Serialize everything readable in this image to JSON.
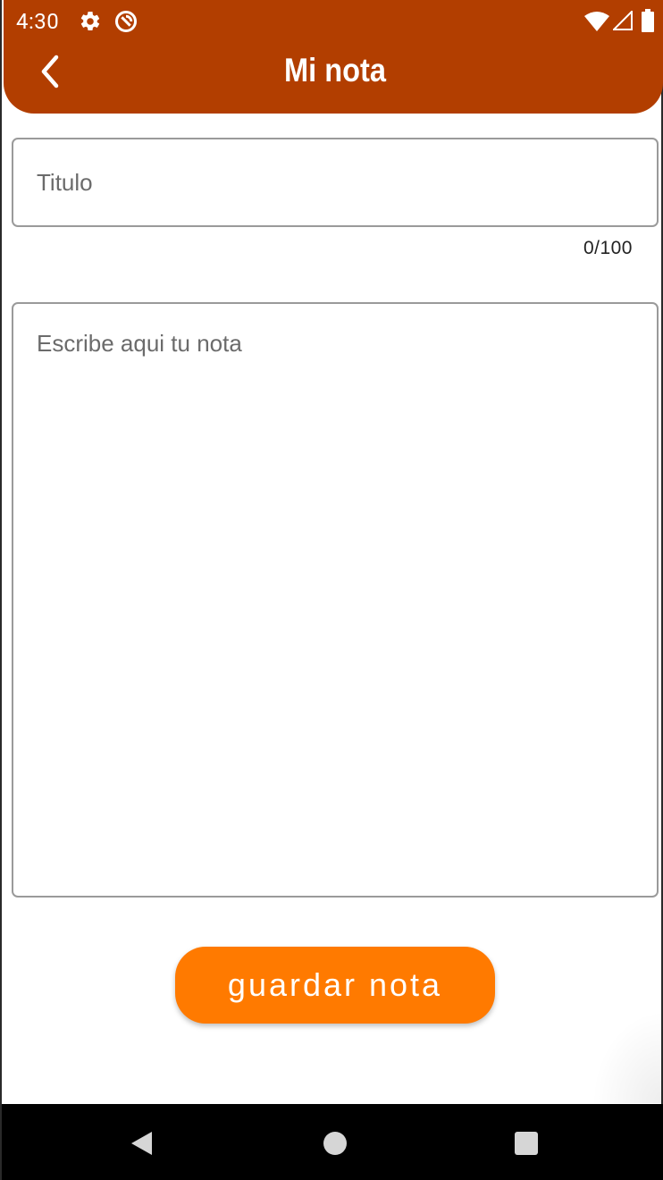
{
  "status_bar": {
    "time": "4:30",
    "icons": [
      "gear-icon",
      "sync-icon",
      "wifi-icon",
      "signal-icon",
      "battery-icon"
    ]
  },
  "app_bar": {
    "title": "Mi nota",
    "back_icon": "chevron-left-icon",
    "background_color": "#b23e00"
  },
  "form": {
    "title_input": {
      "placeholder": "Titulo",
      "value": "",
      "counter": "0/100"
    },
    "note_input": {
      "placeholder": "Escribe aqui tu nota",
      "value": ""
    },
    "save_button": {
      "label": "guardar nota",
      "color": "#ff7a00"
    }
  },
  "nav_bar": {
    "icons": [
      "back-triangle-icon",
      "home-circle-icon",
      "recents-square-icon"
    ]
  }
}
